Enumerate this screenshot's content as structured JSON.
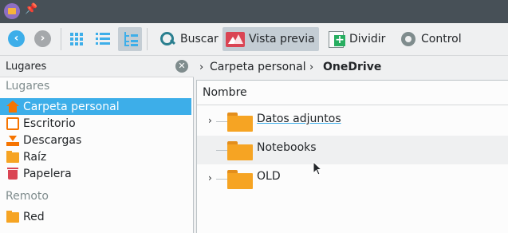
{
  "toolbar": {
    "search_label": "Buscar",
    "preview_label": "Vista previa",
    "split_label": "Dividir",
    "control_label": "Control"
  },
  "places": {
    "panel_title": "Lugares",
    "section_places": "Lugares",
    "items": [
      {
        "label": "Carpeta personal",
        "icon": "home-icon"
      },
      {
        "label": "Escritorio",
        "icon": "desktop-icon"
      },
      {
        "label": "Descargas",
        "icon": "download-icon"
      },
      {
        "label": "Raíz",
        "icon": "folder-icon"
      },
      {
        "label": "Papelera",
        "icon": "trash-icon"
      }
    ],
    "section_remote": "Remoto",
    "remote_items": [
      {
        "label": "Red",
        "icon": "folder-icon"
      }
    ]
  },
  "breadcrumb": {
    "items": [
      "Carpeta personal",
      "OneDrive"
    ]
  },
  "filelist": {
    "column_name": "Nombre",
    "rows": [
      {
        "name": "Datos adjuntos",
        "expandable": true
      },
      {
        "name": "Notebooks",
        "expandable": false
      },
      {
        "name": "OLD",
        "expandable": true
      }
    ]
  },
  "colors": {
    "accent": "#3daee9",
    "titlebar": "#475057",
    "folder": "#f6a423"
  }
}
